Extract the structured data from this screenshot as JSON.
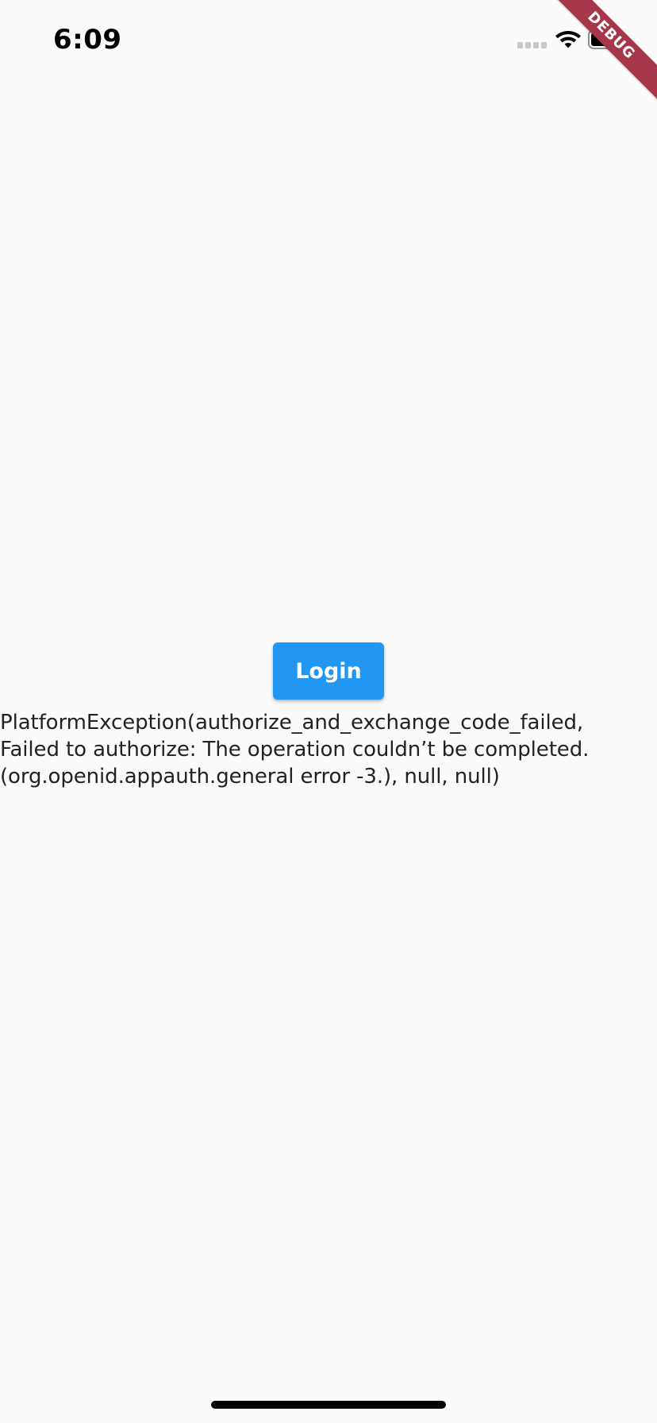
{
  "status_bar": {
    "time": "6:09",
    "icons": {
      "cellular": "cellular-signal-icon",
      "wifi": "wifi-icon",
      "battery": "battery-icon"
    }
  },
  "debug_banner": {
    "label": "DEBUG",
    "color": "#a6364a"
  },
  "main": {
    "login_button_label": "Login",
    "login_button_color": "#2196f3",
    "error_message": "PlatformException(authorize_and_exchange_code_failed,\nFailed to authorize: The operation couldn’t be completed.\n(org.openid.appauth.general error -3.), null, null)"
  }
}
